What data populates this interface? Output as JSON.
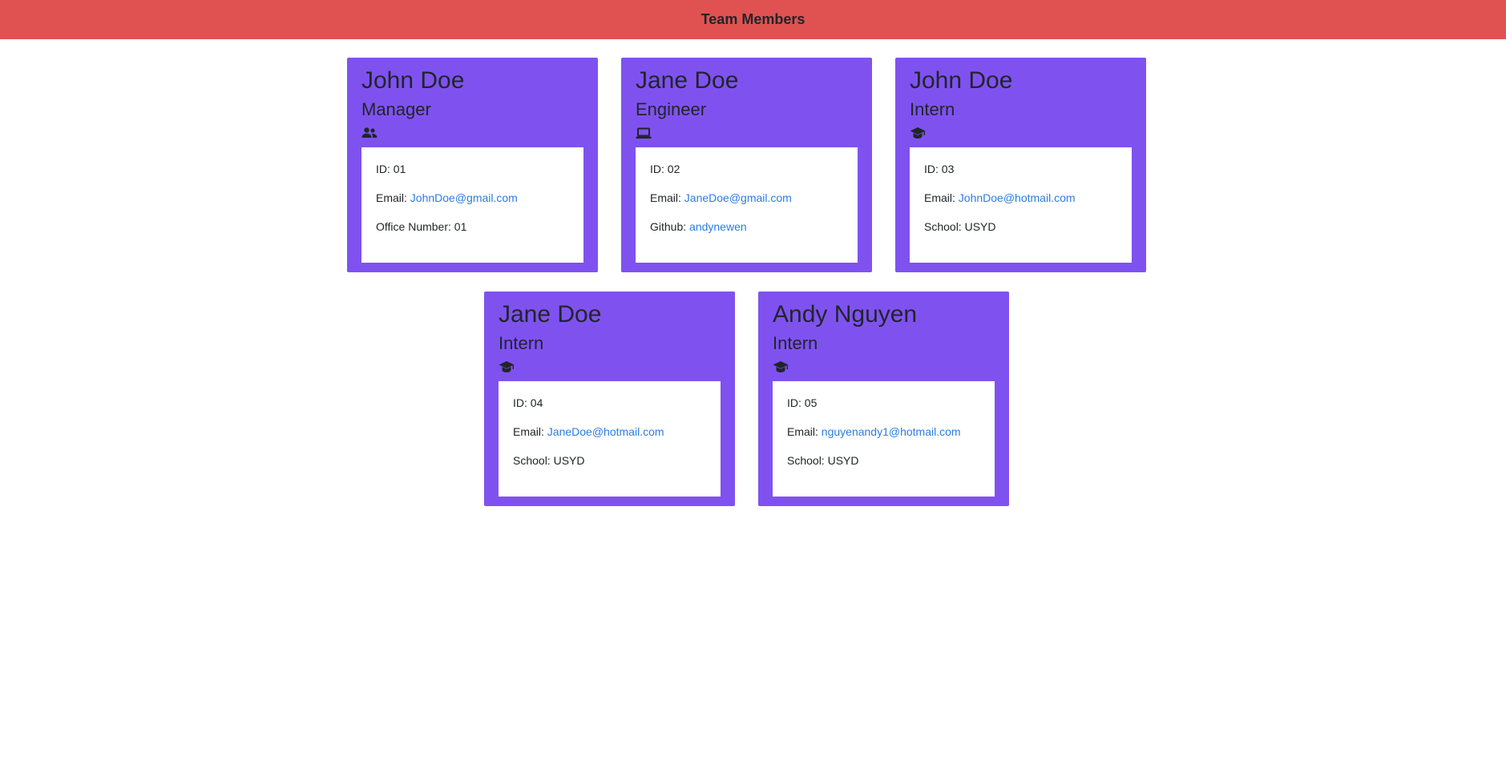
{
  "header": {
    "title": "Team Members"
  },
  "colors": {
    "header_bg": "#e05252",
    "card_bg": "#7f52f0",
    "link": "#2a7de1"
  },
  "members": [
    {
      "name": "John Doe",
      "role": "Manager",
      "icon": "people-icon",
      "id_label": "ID:",
      "id": "01",
      "email_label": "Email:",
      "email": "JohnDoe@gmail.com",
      "extra_label": "Office Number:",
      "extra": "01"
    },
    {
      "name": "Jane Doe",
      "role": "Engineer",
      "icon": "laptop-icon",
      "id_label": "ID:",
      "id": "02",
      "email_label": "Email:",
      "email": "JaneDoe@gmail.com",
      "extra_label": "Github:",
      "extra": "andynewen"
    },
    {
      "name": "John Doe",
      "role": "Intern",
      "icon": "graduation-cap-icon",
      "id_label": "ID:",
      "id": "03",
      "email_label": "Email:",
      "email": "JohnDoe@hotmail.com",
      "extra_label": "School:",
      "extra": "USYD"
    },
    {
      "name": "Jane Doe",
      "role": "Intern",
      "icon": "graduation-cap-icon",
      "id_label": "ID:",
      "id": "04",
      "email_label": "Email:",
      "email": "JaneDoe@hotmail.com",
      "extra_label": "School:",
      "extra": "USYD"
    },
    {
      "name": "Andy Nguyen",
      "role": "Intern",
      "icon": "graduation-cap-icon",
      "id_label": "ID:",
      "id": "05",
      "email_label": "Email:",
      "email": "nguyenandy1@hotmail.com",
      "extra_label": "School:",
      "extra": "USYD"
    }
  ]
}
